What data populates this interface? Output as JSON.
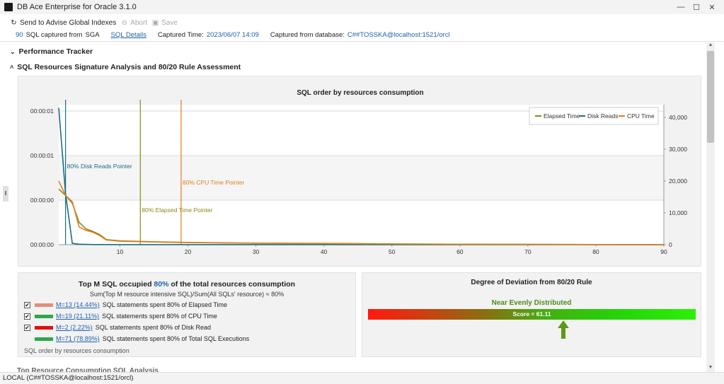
{
  "window": {
    "title": "DB Ace Enterprise for Oracle 3.1.0",
    "controls": [
      "—",
      "☐",
      "✕"
    ]
  },
  "toolbar": {
    "advise_label": "Send to Advise Global Indexes",
    "abort_label": "Abort",
    "save_label": "Save"
  },
  "info": {
    "sql_count": "90",
    "captured_from_label": "SQL captured from",
    "source": "SGA",
    "details_link": "SQL Details",
    "time_label": "Captured Time:",
    "time_value": "2023/06/07 14:09",
    "db_label": "Captured from database:",
    "db_value": "C##TOSSKA@localhost:1521/orcl"
  },
  "sections": {
    "performance_tracker": "Performance Tracker",
    "signature_analysis": "SQL Resources Signature Analysis and 80/20 Rule Assessment",
    "cut_off_next": "Top Resource Consumption SQL Analysis"
  },
  "chart_data": {
    "type": "line",
    "title": "SQL order by resources consumption",
    "x_ticks": [
      10,
      20,
      30,
      40,
      50,
      60,
      70,
      80,
      90
    ],
    "xlim": [
      1,
      90
    ],
    "y_left_ticks": [
      "00:00:01",
      "00:00:01",
      "00:00:00",
      "00:00:00"
    ],
    "y_right_ticks": [
      "40,000",
      "30,000",
      "20,000",
      "10,000",
      "0"
    ],
    "ylim_right": [
      0,
      44000
    ],
    "legend_position": "top-right",
    "series": [
      {
        "name": "Elapsed Time",
        "color": "#8a8a18",
        "x": [
          1,
          2,
          3,
          4,
          5,
          6,
          7,
          8,
          10,
          15,
          20,
          30,
          40,
          50,
          60,
          90
        ],
        "y": [
          17500,
          15500,
          13000,
          7000,
          5000,
          4200,
          3200,
          1600,
          1200,
          900,
          700,
          500,
          400,
          250,
          150,
          0
        ]
      },
      {
        "name": "Disk Reads",
        "color": "#1a6e82",
        "x": [
          1,
          2,
          3,
          4,
          5,
          6,
          10,
          90
        ],
        "y": [
          43000,
          16000,
          400,
          150,
          80,
          50,
          20,
          0
        ]
      },
      {
        "name": "CPU Time",
        "color": "#e07e1c",
        "x": [
          1,
          2,
          3,
          4,
          5,
          6,
          7,
          8,
          10,
          15,
          20,
          30,
          40,
          50,
          60,
          90
        ],
        "y": [
          20000,
          15500,
          13500,
          5600,
          4500,
          3900,
          2900,
          1500,
          1100,
          850,
          650,
          450,
          350,
          220,
          130,
          0
        ]
      }
    ],
    "pointers": [
      {
        "label": "80% Disk Reads Pointer",
        "x": 2,
        "color": "#1a6e82"
      },
      {
        "label": "80% Elapsed Time Pointer",
        "x": 13,
        "color": "#8a8a18"
      },
      {
        "label": "80% CPU Time Pointer",
        "x": 19,
        "color": "#e07e1c"
      }
    ]
  },
  "topm": {
    "title_pre": "Top M SQL occupied",
    "title_pct": "80%",
    "title_post": "of the total resources consumption",
    "subtitle": "Sum(Top M resource intensive SQL)/Sum(All SQLs' resource) ≈ 80%",
    "rows": [
      {
        "checked": true,
        "color": "#e0907a",
        "link": "M=13 (14.44%)",
        "text": "SQL statements spent 80% of Elapsed Time"
      },
      {
        "checked": true,
        "color": "#2ea84a",
        "link": "M=19 (21.11%)",
        "text": "SQL statements spent 80% of CPU Time"
      },
      {
        "checked": true,
        "color": "#e01010",
        "link": "M=2 (2.22%)",
        "text": "SQL statements spent 80% of Disk Read"
      },
      {
        "checked": false,
        "color": "#2ea84a",
        "link": "M=71 (78.89%)",
        "text": "SQL statements spent 80% of Total SQL Executions"
      }
    ],
    "footer": "SQL order by resources consumption"
  },
  "deviation": {
    "title": "Degree of Deviation from 80/20 Rule",
    "label": "Near Evenly Distributed",
    "score_text": "Score = 61.11",
    "score": 61.11
  },
  "status": {
    "connection": "LOCAL (C##TOSSKA@localhost:1521/orcl)"
  }
}
